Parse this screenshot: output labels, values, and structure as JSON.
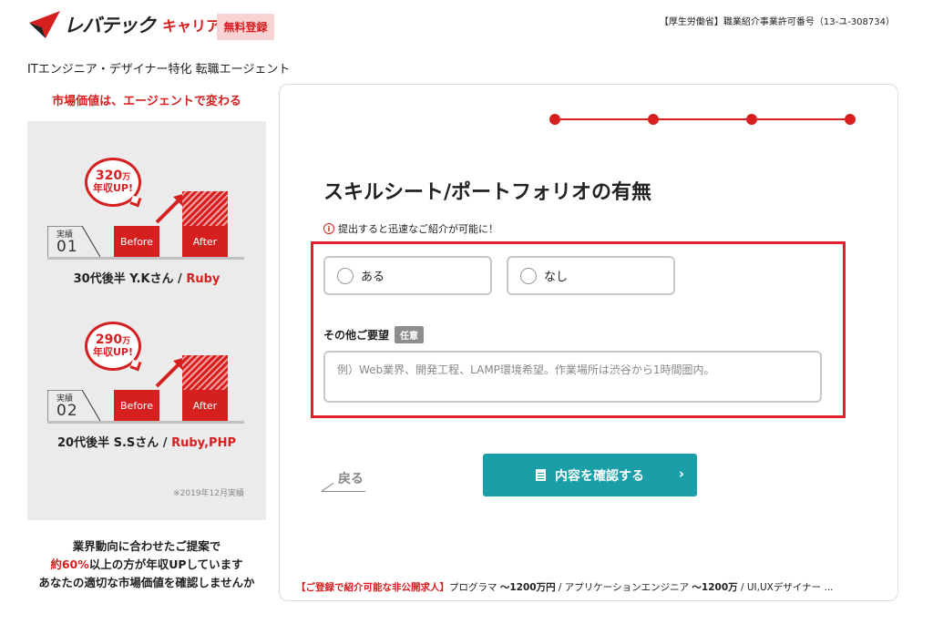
{
  "header": {
    "logo_text": "レバテック",
    "logo_sub": "キャリア",
    "register_label": "無料登録",
    "license": "【厚生労働省】職業紹介事業許可番号（13-ユ-308734）",
    "tagline": "ITエンジニア・デザイナー特化 転職エージェント"
  },
  "sidebar": {
    "title": "市場価値は、エージェントで変わる",
    "cases": [
      {
        "amount": "320",
        "unit": "万",
        "up": "年収UP!",
        "label_small": "実績",
        "num": "01",
        "before": "Before",
        "after": "After",
        "name": "30代後半 Y.Kさん / ",
        "lang": "Ruby"
      },
      {
        "amount": "290",
        "unit": "万",
        "up": "年収UP!",
        "label_small": "実績",
        "num": "02",
        "before": "Before",
        "after": "After",
        "name": "20代後半 S.Sさん / ",
        "lang": "Ruby,PHP"
      }
    ],
    "note": "※2019年12月実績",
    "footer_line1": "業界動向に合わせたご提案で",
    "footer_line2_red": "約60%",
    "footer_line2_rest": "以上の方が年収UPしています",
    "footer_line3": "あなたの適切な市場価値を確認しませんか"
  },
  "form": {
    "title": "スキルシート/ポートフォリオの有無",
    "note_icon": "i",
    "note": "提出すると迅速なご紹介が可能に！",
    "options": [
      "ある",
      "なし"
    ],
    "other_label": "その他ご要望",
    "optional_badge": "任意",
    "other_placeholder": "例）Web業界、開発工程、LAMP環境希望。作業場所は渋谷から1時間圏内。",
    "back_label": "戻る",
    "confirm_label": "内容を確認する",
    "confirm_chevron": "›"
  },
  "ticker": {
    "lead": "【ご登録で紹介可能な非公開求人】",
    "t1": "プログラマ ",
    "v1": "〜1200万円",
    "sep1": " / アプリケーションエンジニア ",
    "v2": "〜1200万",
    "rest": " / UI,UXデザイナー ..."
  },
  "colors": {
    "brand_red": "#d62020",
    "accent_teal": "#1a9fa9",
    "highlight_red": "#e0202a"
  }
}
